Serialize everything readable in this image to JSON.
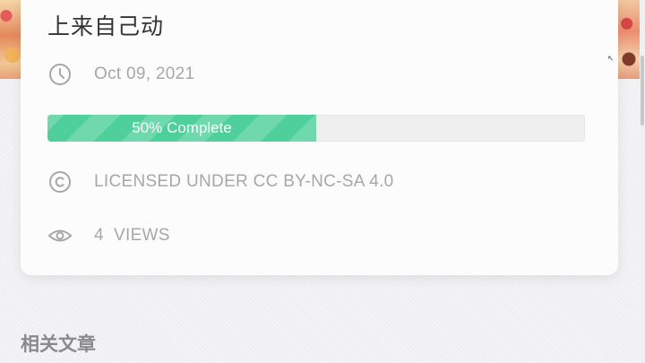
{
  "post": {
    "title": "上来自己动",
    "date": "Oct 09, 2021",
    "progress_percent": 50,
    "progress_label": "50% Complete",
    "license": "LICENSED UNDER CC BY-NC-SA 4.0",
    "views": "4  VIEWS"
  },
  "related": {
    "title": "相关文章"
  },
  "icons": {
    "date": "clock-icon",
    "license": "copyright-icon",
    "views": "eye-icon"
  },
  "colors": {
    "progress": "#4fcf9a",
    "meta_text": "#a7a7a7",
    "title": "#333333"
  }
}
